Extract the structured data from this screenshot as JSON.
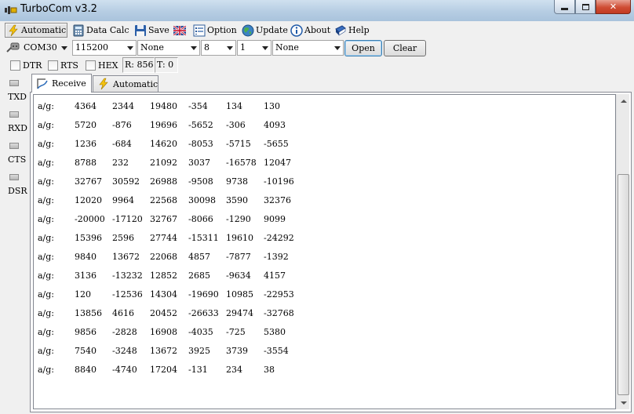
{
  "window": {
    "title": "TurboCom v3.2"
  },
  "toolbar": {
    "automatic": "Automatic",
    "data_calc": "Data Calc",
    "save": "Save",
    "option": "Option",
    "update": "Update",
    "about": "About",
    "help": "Help"
  },
  "serial": {
    "port": "COM30",
    "baud": "115200",
    "parity": "None",
    "data_bits": "8",
    "stop_bits": "1",
    "flow": "None",
    "open_label": "Open",
    "clear_label": "Clear"
  },
  "options": {
    "dtr": "DTR",
    "rts": "RTS",
    "hex": "HEX"
  },
  "counters": {
    "rx": "R: 856",
    "tx": "T: 0"
  },
  "signals": {
    "txd": "TXD",
    "rxd": "RXD",
    "cts": "CTS",
    "dsr": "DSR"
  },
  "tabs": {
    "receive": "Receive",
    "automatic": "Automatic"
  },
  "receive": {
    "rows": [
      [
        "a/g:",
        "4364",
        "2344",
        "19480",
        "-354",
        "134",
        "130"
      ],
      [
        "a/g:",
        "5720",
        "-876",
        "19696",
        "-5652",
        "-306",
        "4093"
      ],
      [
        "a/g:",
        "1236",
        "-684",
        "14620",
        "-8053",
        "-5715",
        "-5655"
      ],
      [
        "a/g:",
        "8788",
        "232",
        "21092",
        "3037",
        "-16578",
        "12047"
      ],
      [
        "a/g:",
        "32767",
        "30592",
        "26988",
        "-9508",
        "9738",
        "-10196"
      ],
      [
        "a/g:",
        "12020",
        "9964",
        "22568",
        "30098",
        "3590",
        "32376"
      ],
      [
        "a/g:",
        "-20000",
        "-17120",
        "32767",
        "-8066",
        "-1290",
        "9099"
      ],
      [
        "a/g:",
        "15396",
        "2596",
        "27744",
        "-15311",
        "19610",
        "-24292"
      ],
      [
        "a/g:",
        "9840",
        "13672",
        "22068",
        "4857",
        "-7877",
        "-1392"
      ],
      [
        "a/g:",
        "3136",
        "-13232",
        "12852",
        "2685",
        "-9634",
        "4157"
      ],
      [
        "a/g:",
        "120",
        "-12536",
        "14304",
        "-19690",
        "10985",
        "-22953"
      ],
      [
        "a/g:",
        "13856",
        "4616",
        "20452",
        "-26633",
        "29474",
        "-32768"
      ],
      [
        "a/g:",
        "9856",
        "-2828",
        "16908",
        "-4035",
        "-725",
        "5380"
      ],
      [
        "a/g:",
        "7540",
        "-3248",
        "13672",
        "3925",
        "3739",
        "-3554"
      ],
      [
        "a/g:",
        "8840",
        "-4740",
        "17204",
        "-131",
        "234",
        "38"
      ]
    ]
  }
}
